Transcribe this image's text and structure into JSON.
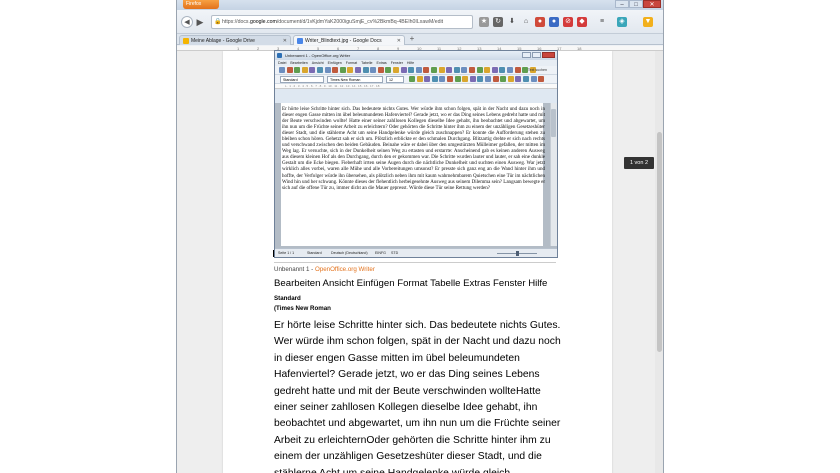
{
  "browser": {
    "app_button": "Firefox",
    "url_prefix": "https://docs.",
    "url_host": "google.com",
    "url_rest": "/document/d/1vKjdmYaK2000iguSmjE_cv%2BkmBq-4BEIh0ILxawM/edit",
    "tabs": [
      {
        "label": "Meine Ablage - Google Drive"
      },
      {
        "label": "Writer_Blindtext.jpg - Google Docs"
      }
    ],
    "ruler_numbers": [
      "1",
      "2",
      "3",
      "4",
      "5",
      "6",
      "7",
      "8",
      "9",
      "10",
      "11",
      "12",
      "13",
      "14",
      "15",
      "16",
      "17",
      "18"
    ],
    "page_indicator": "1 von 2"
  },
  "oo_window": {
    "title": "Unbenannt 1 - OpenOffice.org Writer",
    "menu": [
      "Datei",
      "Bearbeiten",
      "Ansicht",
      "Einfügen",
      "Format",
      "Tabelle",
      "Extras",
      "Fenster",
      "Hilfe"
    ],
    "style": "Standard",
    "font": "Times New Roman",
    "size": "12",
    "search_label": "Text suchen",
    "ruler": "L · 1 · 2 · 3 · 4 · 5 · 6 · 7 · 8 · 9 · 10 · 11 · 12 · 13 · 14 · 15 · 16 · 17 · 18",
    "text": "Er hörte leise Schritte hinter sich. Das bedeutete nichts Gutes. Wer würde ihm schon folgen, spät in der Nacht und dazu noch in dieser engen Gasse mitten im übel beleumundeten Hafenviertel? Gerade jetzt, wo er das Ding seines Lebens gedreht hatte und mit der Beute verschwinden wollte! Hatte einer seiner zahllosen Kollegen dieselbe Idee gehabt, ihn beobachtet und abgewartet, um ihn nun um die Früchte seiner Arbeit zu erleichtern? Oder gehörten die Schritte hinter ihm zu einem der unzähligen Gesetzeshüter dieser Stadt, und die stählerne Acht um seine Handgelenke würde gleich zuschnappen? Er konnte die Aufforderung stehen zu bleiben schon hören. Gehetzt sah er sich um. Plötzlich erblickte er den schmalen Durchgang. Blitzartig drehte er sich nach rechts und verschwand zwischen den beiden Gebäuden. Beinahe wäre er dabei über den umgestürzten Mülleimer gefallen, der mitten im Weg lag. Er versuchte, sich in der Dunkelheit seinen Weg zu ertasten und erstarrte: Anscheinend gab es keinen anderen Ausweg aus diesem kleinen Hof als den Durchgang, durch den er gekommen war. Die Schritte wurden lauter und lauter, er sah eine dunkle Gestalt um die Ecke biegen. Fieberhaft irrten seine Augen durch die nächtliche Dunkelheit und suchten einen Ausweg. War jetzt wirklich alles vorbei, waren alle Mühe und alle Vorbereitungen umsonst? Er presste sich ganz eng an die Wand hinter ihm und hoffte, der Verfolger würde ihn übersehen, als plötzlich neben ihm mit kaum wahrnehmbarem Quietschen eine Tür im nächtlichen Wind hin und her schwang. Könnte dieses der flehentlich herbeigesehnte Ausweg aus seinem Dilemma sein? Langsam bewegte er sich auf die offene Tür zu, immer dicht an die Mauer gepresst. Würde diese Tür seine Rettung werden?",
    "status": {
      "page": "Seite 1 / 1",
      "style": "Standard",
      "lang": "Deutsch (Deutschland)",
      "mode": "EINFG",
      "sel": "STD"
    }
  },
  "ocr": {
    "heading_prefix": "Unbenannt 1 - ",
    "heading_app": "OpenOffice.org Writer",
    "menu": "Bearbeiten Ansicht Einfügen Format Tabelle Extras Fenster Hilfe",
    "style": "Standard",
    "font": "(Times New Roman",
    "body": "Er hörte leise Schritte hinter sich. Das bedeutete nichts Gutes. Wer würde ihm schon folgen, spät in der Nacht und dazu noch in dieser engen Gasse mitten im übel beleumundeten Hafenviertel? Gerade jetzt, wo er das Ding seines Lebens gedreht hatte und mit der Beute verschwinden wollteHatte einer seiner zahllosen Kollegen dieselbe Idee gehabt, ihn beobachtet und abgewartet, um ihn nun um die Früchte seiner Arbeit zu erleichternOder gehörten die Schritte hinter ihm zu einem der unzähligen Gesetzeshüter dieser Stadt, und die stählerne Acht um seine Handgelenke würde gleich"
  },
  "colors": {
    "firefox_orange": "#e2711b",
    "openoffice_orange": "#e3721c",
    "google_docs_blue": "#4a86e8"
  }
}
